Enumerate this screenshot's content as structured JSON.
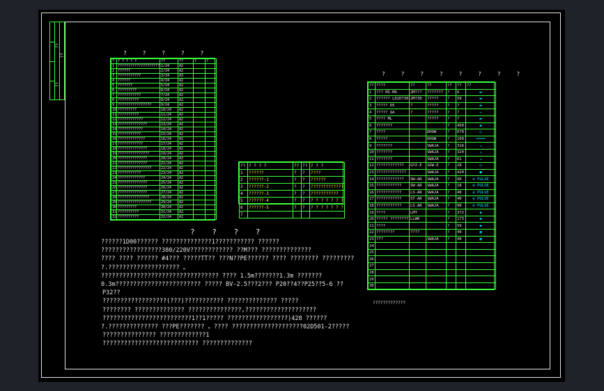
{
  "side_block": {
    "labels": [
      "??",
      "??",
      "??"
    ]
  },
  "table_left": {
    "title": "? ? ? ? ?",
    "header": [
      "?",
      "? ? ? ? ?",
      "??",
      "??",
      "?",
      "?"
    ],
    "rows": [
      [
        "1",
        "?????????????????????",
        "1/24",
        "A2"
      ],
      [
        "2",
        "??????",
        "2/24",
        "A2"
      ],
      [
        "3",
        "???????????",
        "3/24",
        "A3"
      ],
      [
        "4",
        "??????",
        "4/24",
        "A2"
      ],
      [
        "5",
        "???????",
        "5/24",
        "A2"
      ],
      [
        "6",
        "?????????",
        "6/24",
        "A2"
      ],
      [
        "7",
        "???????????",
        "7/24",
        "A2"
      ],
      [
        "8",
        "??????????",
        "8/24",
        "A2"
      ],
      [
        "9",
        "????????????????",
        "9/24",
        "A2"
      ],
      [
        "10",
        "?????????",
        "10/24",
        "A2"
      ],
      [
        "11",
        "??????????",
        "11/24",
        "A2"
      ],
      [
        "12",
        "????????????",
        "12/24",
        "A2"
      ],
      [
        "13",
        "??????????????",
        "13/24",
        "A2"
      ],
      [
        "14",
        "????????????",
        "14/24",
        "A2"
      ],
      [
        "15",
        "???????????",
        "15/24",
        "A2"
      ],
      [
        "16",
        "?????????????",
        "16/24",
        "A2"
      ],
      [
        "17",
        "????????????",
        "17/24",
        "A2"
      ],
      [
        "18",
        "??????????????",
        "18/24",
        "A2"
      ],
      [
        "19",
        "???????????????",
        "19/24",
        "A2"
      ],
      [
        "20",
        "??????????????",
        "20/24",
        "A2"
      ],
      [
        "21",
        "??????????????",
        "21/24",
        "A2"
      ],
      [
        "22",
        "????????????????",
        "22/24",
        "A2"
      ],
      [
        "23",
        "???????????",
        "23/24",
        "A2"
      ],
      [
        "24",
        "?????????????",
        "24/24",
        "A2"
      ],
      [
        "25",
        "??????????????",
        "25/24",
        "A2"
      ],
      [
        "26",
        "??????????????",
        "26/24",
        "A2"
      ],
      [
        "27",
        "??????????????",
        "27/24",
        "A2"
      ],
      [
        "28",
        "???????????????",
        "28/24",
        "A2"
      ],
      [
        "29",
        "????????????????",
        "29/24",
        "A2"
      ],
      [
        "30",
        "?????????",
        "30/24",
        "A2"
      ],
      [
        "31",
        "??????????",
        "31/24",
        "A2"
      ],
      [
        "32",
        "??????????",
        "32/24",
        "A2"
      ]
    ]
  },
  "table_mid": {
    "title": "??????",
    "header": [
      "??",
      "? ? ? ?",
      "??",
      "??",
      "? ? ?"
    ],
    "rows": [
      [
        "1",
        "??????",
        "?",
        "?",
        "????"
      ],
      [
        "2",
        "??????-1",
        "?",
        "?",
        "??????"
      ],
      [
        "3",
        "??????-2",
        "?",
        "?",
        "?????????????"
      ],
      [
        "4",
        "??????-3",
        "?",
        "?",
        "???????????"
      ],
      [
        "5",
        "??????-4",
        "?",
        "?",
        "? ? ? ? ? ? ?"
      ],
      [
        "6",
        "??????-5",
        "?",
        "?",
        "? ? ? ? ? ? ?"
      ],
      [
        "7",
        "",
        "",
        "",
        ""
      ]
    ]
  },
  "table_right": {
    "title": "? ? ? ? ? ? ? ?",
    "header": [
      "??",
      "????",
      "??",
      "??",
      "??",
      "??",
      "??"
    ],
    "rows": [
      [
        "1",
        "???    MI-M6",
        "2M???",
        "???????",
        "?",
        "6",
        "▬"
      ],
      [
        "2",
        "?????? LD2D730",
        "2M?30",
        "?????",
        "?",
        "59",
        "▬"
      ],
      [
        "3",
        "?????   D5",
        "?",
        "?????",
        "?",
        "?",
        "▬"
      ],
      [
        "4",
        "?????   QA",
        "?",
        "?????",
        "?",
        "?",
        "→"
      ],
      [
        "5",
        "????   ML",
        "",
        "?????",
        "?",
        "?",
        "▬"
      ],
      [
        "6",
        "???????",
        "",
        "",
        "?",
        "450",
        "◆"
      ],
      [
        "7",
        "????",
        "",
        "DHOW",
        "?",
        "670",
        "○"
      ],
      [
        "8",
        "?????",
        "",
        "DHOW",
        "?",
        "100",
        "━━━━"
      ],
      [
        "9",
        "???????",
        "",
        "SWAJA",
        "?",
        "316",
        "↘"
      ],
      [
        "10",
        "???????",
        "",
        "SWAJA",
        "?",
        "324",
        "↘"
      ],
      [
        "11",
        "???????",
        "",
        "SWAJA",
        "?",
        "61",
        "↘"
      ],
      [
        "12",
        "????????????",
        "GYZ-E",
        "SOW-E",
        "?",
        "28",
        "○"
      ],
      [
        "13",
        "?????????????",
        "",
        "SWAJA",
        "?",
        "420",
        "●"
      ],
      [
        "14",
        "????????????",
        "SW-AR",
        "SWAJA",
        "?",
        "90",
        "⊗ PULSE"
      ],
      [
        "15",
        "???????????",
        "SW-AR",
        "SWAJA",
        "?",
        "18",
        "⊗ PULSE"
      ],
      [
        "16",
        "???????????",
        "LS-AR",
        "SWAJA",
        "?",
        "40",
        "⊗ PULSE"
      ],
      [
        "17",
        "???????????",
        "ST-AR",
        "SWAJA",
        "?",
        "40",
        "⊗ PULSE"
      ],
      [
        "18",
        "???????????",
        "LS-AR",
        "SWAJA",
        "?",
        "90",
        "⊗ PULSE"
      ],
      [
        "19",
        "????",
        "LMT",
        "",
        "?",
        "372",
        "◆"
      ],
      [
        "20",
        "?????  ?????????",
        "LLWR",
        "",
        "?",
        "173",
        "◆"
      ],
      [
        "21",
        "????",
        "",
        "",
        "?",
        "59",
        "◆"
      ],
      [
        "22",
        "????????",
        "????",
        "",
        "?",
        "40",
        "▣"
      ],
      [
        "23",
        "???",
        "",
        "SWAJA",
        "?",
        "40",
        "▣"
      ],
      [
        "24",
        "",
        "",
        "",
        "",
        "",
        ""
      ],
      [
        "25",
        "",
        "",
        "",
        "",
        "",
        ""
      ],
      [
        "26",
        "",
        "",
        "",
        "",
        "",
        ""
      ],
      [
        "27",
        "",
        "",
        "",
        "",
        "",
        ""
      ],
      [
        "28",
        "",
        "",
        "",
        "",
        "",
        ""
      ],
      [
        "29",
        "",
        "",
        "",
        "",
        "",
        ""
      ],
      [
        "30",
        "",
        "",
        "",
        "",
        "",
        ""
      ]
    ],
    "footnote": "?????????????"
  },
  "notes": {
    "title": "? ? ? ?",
    "lines": [
      "??????1D00?????? ??????????????1??????????? ??????",
      "?????????????????380/220V????????????       ??M???  ??????????????",
      "???? ???? ??????  #4??? ?????TT?? ???N??PE?????? ???? ????????  ?????????",
      "?.???????????????????? 。",
      "????????????????????????????????? ???? 1.5m???????1.3m ???????",
      "0.3m????????????????????????  ????? BV-2.5???2???  P20??4??P25??5-6 ??",
      "P32??",
      "??????????????????(???)???????????       ??????????????    ?????",
      "????????  ??????????????    ???????????????,????????????????????",
      "?????????????????????????1??1?????             ?????????????????)428   ??????",
      "?.?????????????? ???PE??????? 。???? ????????????????????02D501-2?????",
      "???????????????       ?????????????1",
      "???????????????????????????             ??????????????"
    ]
  }
}
